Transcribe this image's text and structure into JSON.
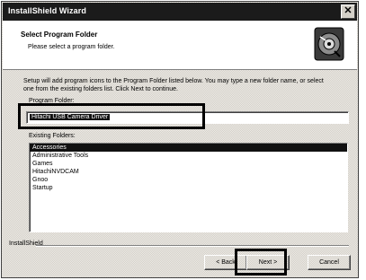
{
  "window": {
    "title": "InstallShield Wizard",
    "close_glyph": "✕"
  },
  "header": {
    "title": "Select Program Folder",
    "subtitle": "Please select a program folder.",
    "icon": "installer-disc-icon"
  },
  "description": "Setup will add program icons to the Program Folder listed below. You may type a new folder name, or select one from the existing folders list. Click Next to continue.",
  "program_folder": {
    "label": "Program Folder:",
    "value": "Hitachi USB Camera Driver"
  },
  "existing_folders": {
    "label": "Existing Folders:",
    "items": [
      "Accessories",
      "Administrative Tools",
      "Games",
      "HitachiNVDCAM",
      "Gnoo",
      "Startup"
    ],
    "selected_index": 0
  },
  "footer": {
    "label": "InstallShield"
  },
  "buttons": {
    "back": "< Back",
    "next": "Next >",
    "cancel": "Cancel"
  },
  "colors": {
    "title_bar": "#1b1b1b",
    "face": "#d4d0c8",
    "selection": "#111111",
    "highlight_outline": "#000000"
  }
}
